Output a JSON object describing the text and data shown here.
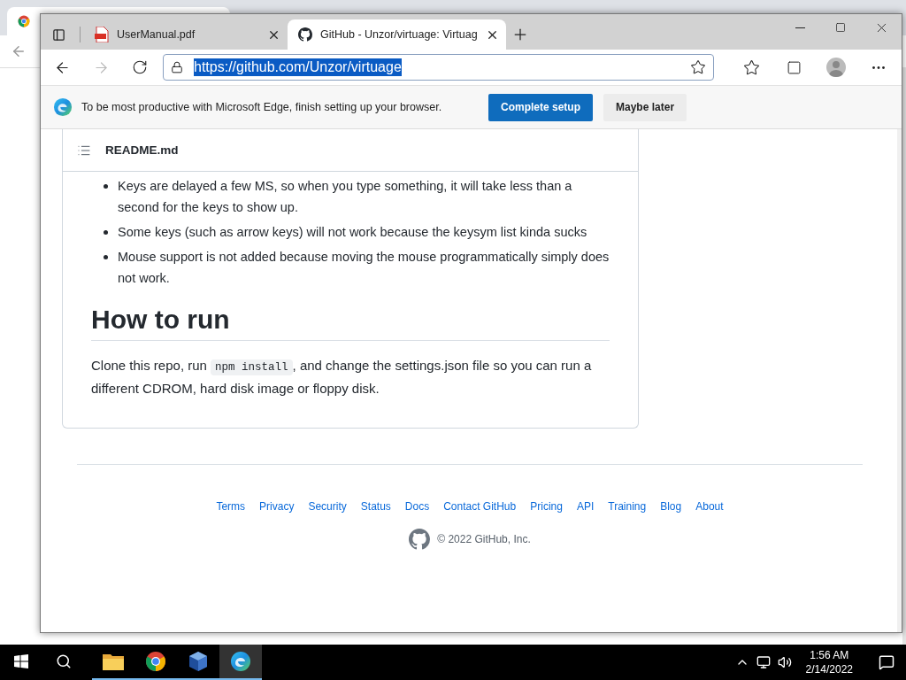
{
  "tabs": [
    {
      "kind": "pdf",
      "label": "UserManual.pdf",
      "selected": false
    },
    {
      "kind": "github",
      "label": "GitHub - Unzor/virtuage: Virtuag",
      "selected": true
    }
  ],
  "address_bar": {
    "url": "https://github.com/Unzor/virtuage",
    "selected": true
  },
  "infobar": {
    "message": "To be most productive with Microsoft Edge, finish setting up your browser.",
    "primary_button": "Complete setup",
    "secondary_button": "Maybe later"
  },
  "readme": {
    "title": "README.md",
    "bullets": [
      "Keys are delayed a few MS, so when you type something, it will take less than a second for the keys to show up.",
      "Some keys (such as arrow keys) will not work because the keysym list kinda sucks",
      "Mouse support is not added because moving the mouse programmatically simply does not work."
    ],
    "heading": "How to run",
    "paragraph": [
      {
        "kind": "text",
        "text": "Clone this repo, run "
      },
      {
        "kind": "code",
        "text": "npm install"
      },
      {
        "kind": "text",
        "text": ", and change the settings.json file so you can run a different CDROM, hard disk image or floppy disk."
      }
    ]
  },
  "footer": {
    "links": [
      "Terms",
      "Privacy",
      "Security",
      "Status",
      "Docs",
      "Contact GitHub",
      "Pricing",
      "API",
      "Training",
      "Blog",
      "About"
    ],
    "copyright": "© 2022 GitHub, Inc."
  },
  "taskbar": {
    "apps": [
      {
        "kind": "explorer",
        "selected": false
      },
      {
        "kind": "chrome",
        "selected": false
      },
      {
        "kind": "virtualbox",
        "selected": false
      },
      {
        "kind": "edge",
        "selected": true
      }
    ],
    "time": "1:56 AM",
    "date": "2/14/2022"
  }
}
